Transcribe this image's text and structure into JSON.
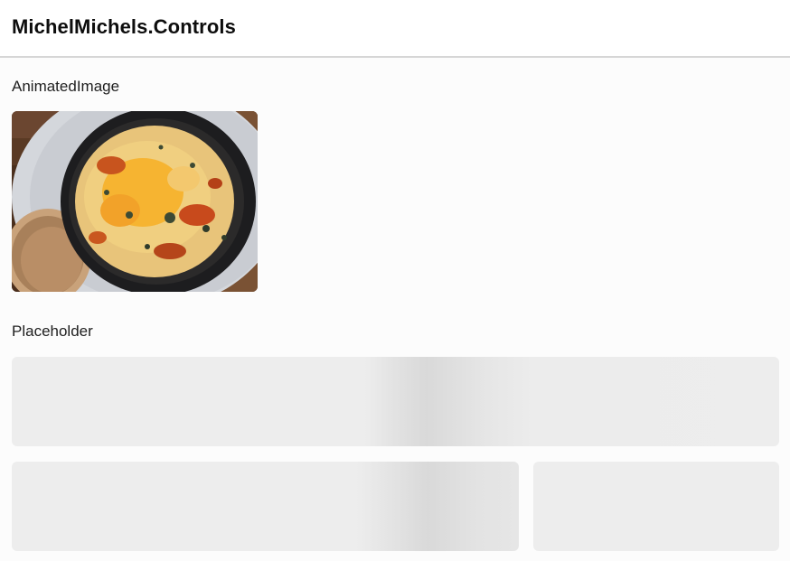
{
  "header": {
    "title": "MichelMichels.Controls"
  },
  "sections": {
    "animated_image": {
      "label": "AnimatedImage",
      "image_subject": "skillet of baked cheesy dish with toast"
    },
    "placeholder": {
      "label": "Placeholder"
    }
  },
  "colors": {
    "background": "#fcfcfc",
    "header_bg": "#ffffff",
    "divider": "#d6d6d6",
    "placeholder_base": "#ededed",
    "placeholder_shimmer": "#d9d9d9"
  }
}
